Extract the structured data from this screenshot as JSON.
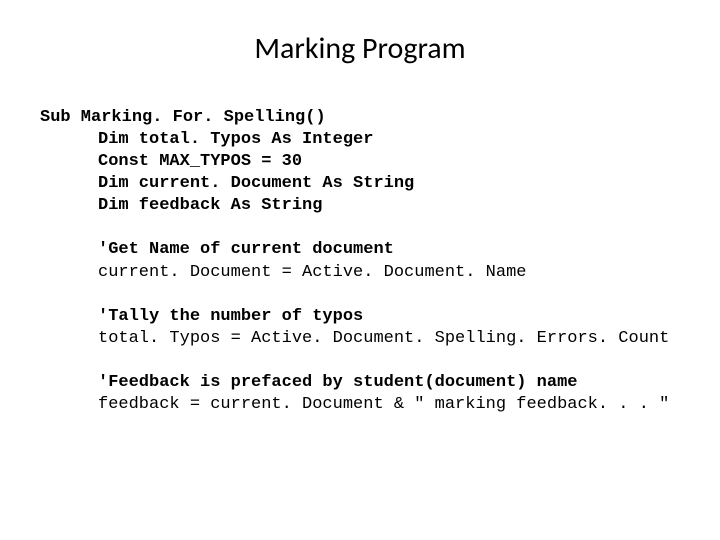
{
  "title": "Marking Program",
  "code": {
    "l0": "Sub Marking. For. Spelling()",
    "l1": "Dim total. Typos As Integer",
    "l2": "Const MAX_TYPOS = 30",
    "l3": "Dim current. Document As String",
    "l4": "Dim feedback As String",
    "l5": "'Get Name of current document",
    "l6": "current. Document = Active. Document. Name",
    "l7": "'Tally the number of typos",
    "l8": "total. Typos = Active. Document. Spelling. Errors. Count",
    "l9": "'Feedback is prefaced by student(document) name",
    "l10": "feedback = current. Document & \" marking feedback. . . \""
  }
}
